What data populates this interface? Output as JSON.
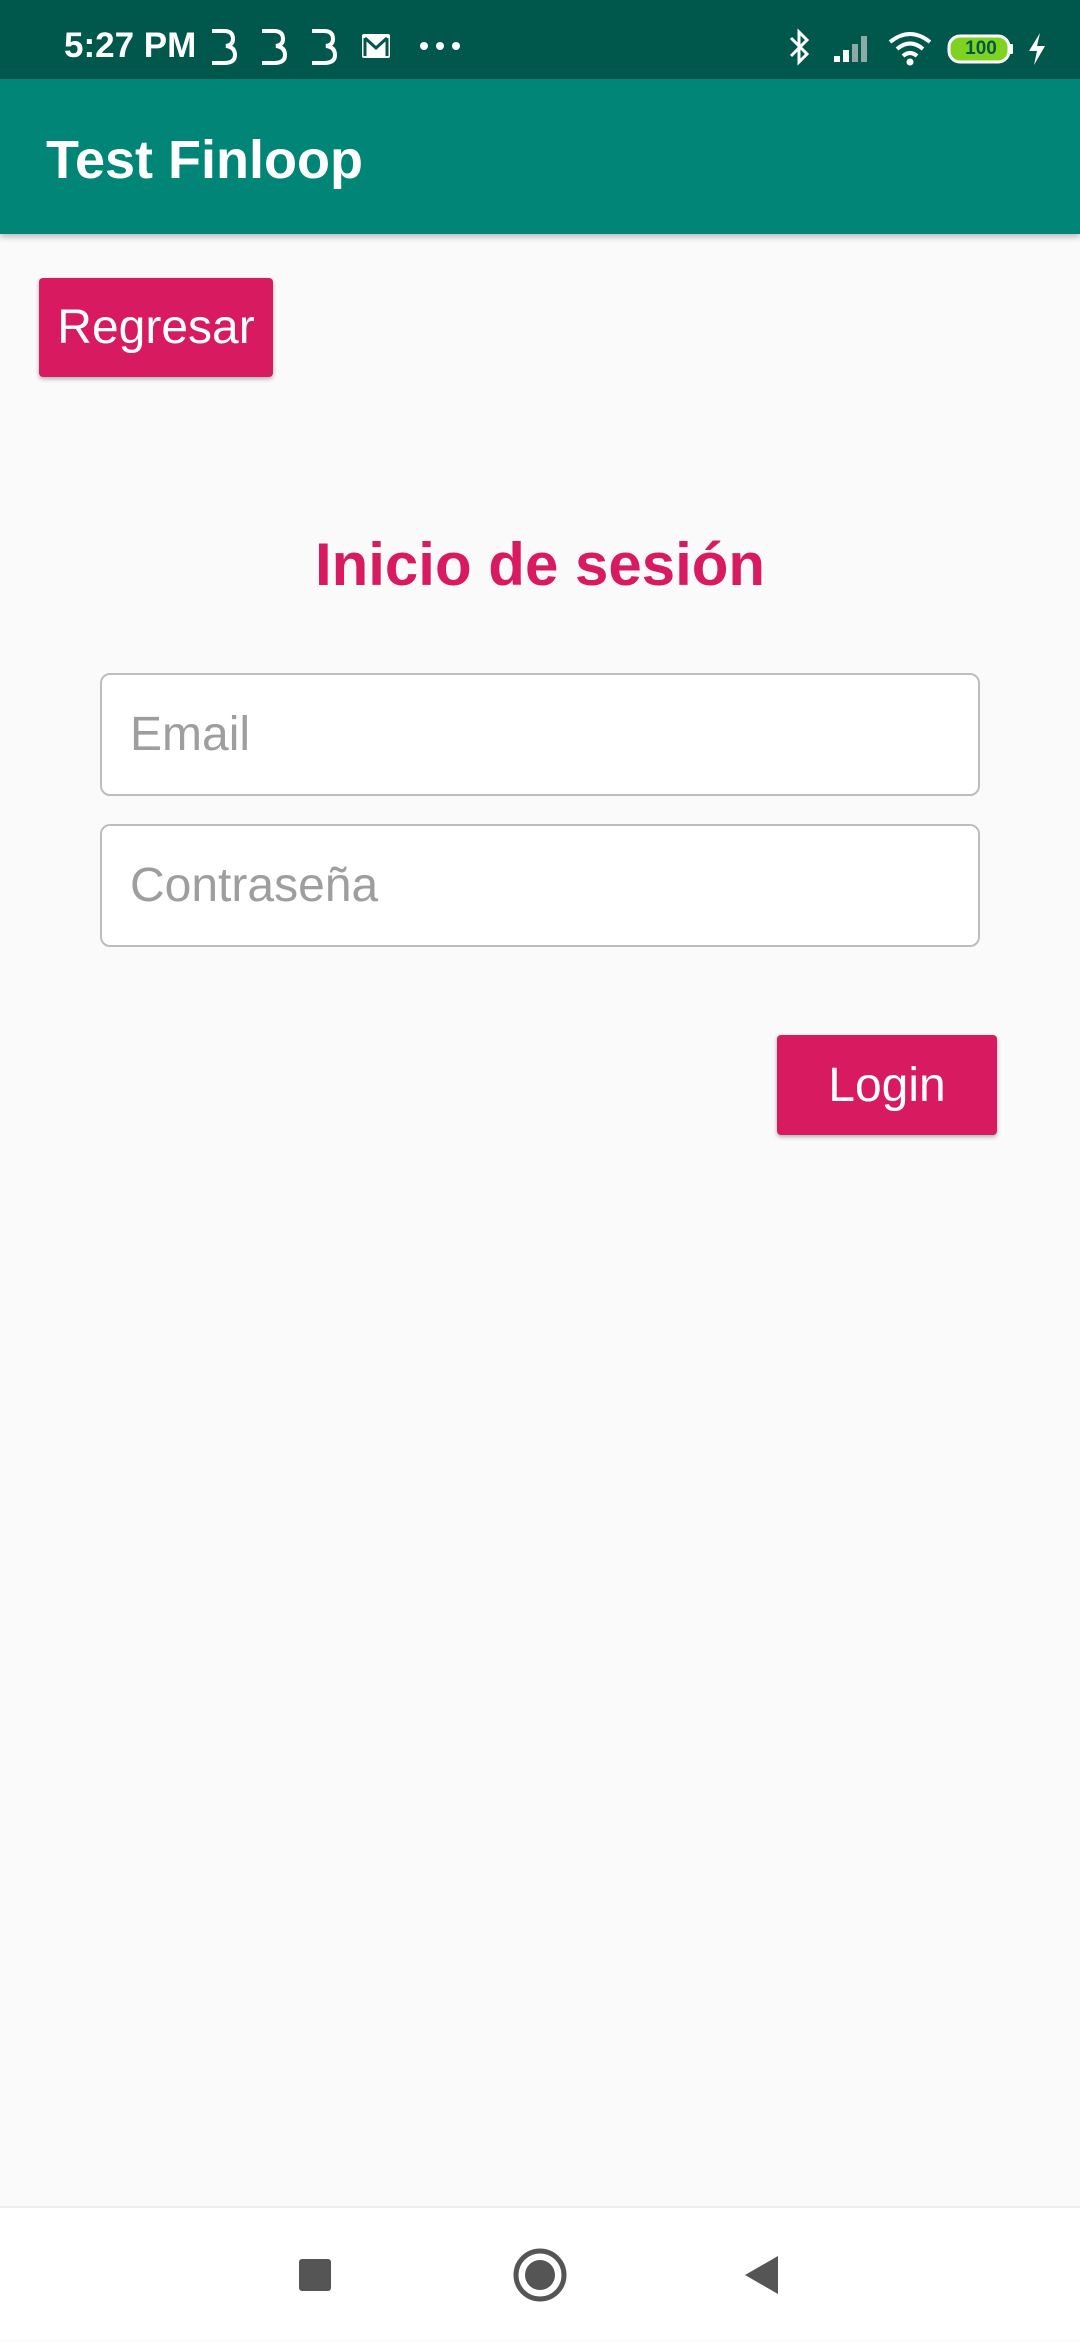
{
  "status_bar": {
    "time": "5:27 PM",
    "battery": "100",
    "left_icons": [
      "b-notification-icon",
      "b-notification-icon",
      "b-notification-icon",
      "gmail-icon",
      "more-dots-icon"
    ],
    "right_icons": [
      "bluetooth-icon",
      "signal-icon",
      "wifi-icon",
      "battery-icon",
      "charging-icon"
    ]
  },
  "app_bar": {
    "title": "Test Finloop"
  },
  "back_button": {
    "label": "Regresar"
  },
  "login_form": {
    "title": "Inicio de sesión",
    "email": {
      "placeholder": "Email",
      "value": ""
    },
    "password": {
      "placeholder": "Contraseña",
      "value": ""
    },
    "submit_label": "Login"
  },
  "nav_bar": {
    "buttons": [
      "recents-icon",
      "home-icon",
      "back-icon"
    ]
  },
  "colors": {
    "status_bar": "#00574b",
    "app_bar": "#008577",
    "accent": "#d81b60",
    "background": "#fafafa"
  }
}
